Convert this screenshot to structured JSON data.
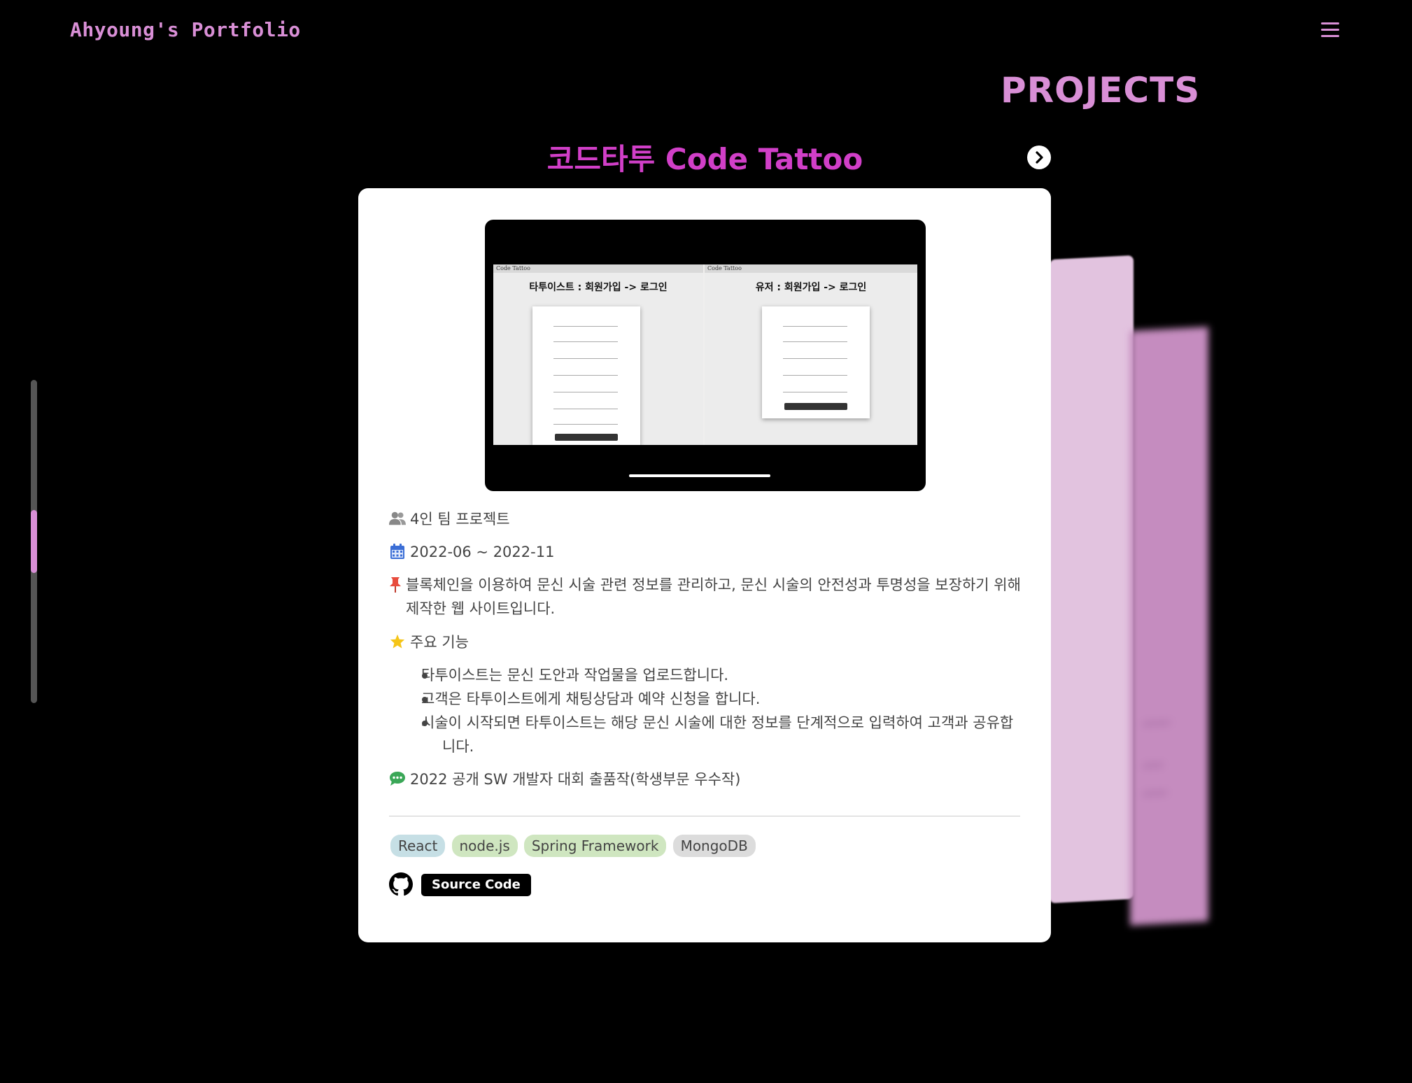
{
  "header": {
    "brand": "Ahyoung's Portfolio",
    "menu_icon": "hamburger-menu-icon"
  },
  "section": {
    "title": "PROJECTS"
  },
  "project": {
    "title": "코드타투 Code Tattoo",
    "next_icon": "chevron-right-icon",
    "screenshot": {
      "left_bar": "Code Tattoo",
      "left_heading": "타투이스트 : 회원가입 -> 로그인",
      "right_bar": "Code Tattoo",
      "right_heading": "유저 : 회원가입 -> 로그인"
    },
    "team": "4인 팀 프로젝트",
    "period": "2022-06 ~ 2022-11",
    "description": "블록체인을 이용하여 문신 시술 관련 정보를 관리하고, 문신 시술의 안전성과 투명성을 보장하기 위해 제작한 웹 사이트입니다.",
    "features_label": "주요 기능",
    "features": [
      "타투이스트는 문신 도안과 작업물을 업로드합니다.",
      "고객은 타투이스트에게 채팅상담과 예약 신청을 합니다.",
      "시술이 시작되면 타투이스트는 해당 문신 시술에 대한 정보를 단계적으로 입력하여 고객과 공유합니다."
    ],
    "award": "2022 공개 SW 개발자 대회 출품작(학생부문 우수작)",
    "tags": [
      {
        "label": "React",
        "color": "#c6dfe5"
      },
      {
        "label": "node.js",
        "color": "#cfe6c0"
      },
      {
        "label": "Spring Framework",
        "color": "#cfe6c0"
      },
      {
        "label": "MongoDB",
        "color": "#dcdcdc"
      }
    ],
    "source_button": "Source Code"
  },
  "colors": {
    "accent": "#d98fd6",
    "title_magenta": "#d13fc8",
    "background": "#000000"
  },
  "scroll": {
    "position": 0.5
  }
}
